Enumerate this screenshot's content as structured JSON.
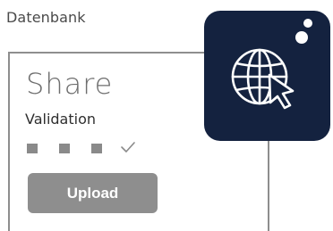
{
  "header": {
    "label": "Datenbank"
  },
  "card": {
    "logo_text": "Share",
    "validation_label": "Validation",
    "steps": {
      "completed_boxes": 3,
      "final_icon": "checkmark-icon"
    },
    "upload_label": "Upload"
  },
  "badge": {
    "icon": "web-cursor-icon"
  },
  "colors": {
    "badge_bg": "#14223f",
    "button_bg": "#8e8e8e",
    "border": "#8e8e8e"
  }
}
